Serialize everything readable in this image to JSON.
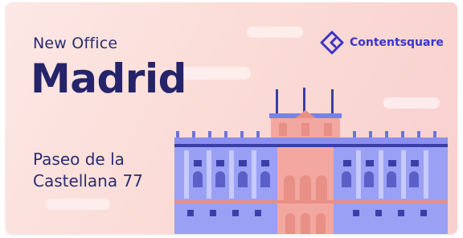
{
  "card": {
    "kicker": "New Office",
    "city": "Madrid",
    "address_line1": "Paseo de la",
    "address_line2": "Castellana 77"
  },
  "brand": {
    "name": "Contentsquare",
    "logo_icon": "contentsquare-logo-icon"
  },
  "colors": {
    "text": "#25246a",
    "brand": "#3b34c9",
    "background": "#fbdcd7",
    "building_blue": "#8a8ff0",
    "building_pink": "#f2a7a0"
  }
}
